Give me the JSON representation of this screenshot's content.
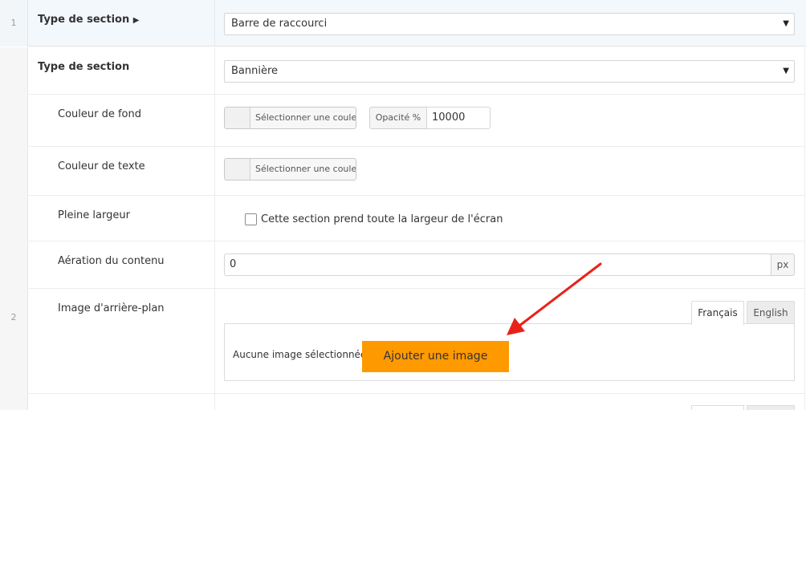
{
  "rows": {
    "row1_number": "1",
    "row2_number": "2"
  },
  "section1": {
    "label": "Type de section",
    "label_icon": "caret-right-icon",
    "select_value": "Barre de raccourci"
  },
  "section2": {
    "label": "Type de section",
    "select_value": "Bannière",
    "bg_color": {
      "label": "Couleur de fond",
      "button_label": "Sélectionner une couleur",
      "opacity_label": "Opacité %",
      "opacity_value": "10000"
    },
    "text_color": {
      "label": "Couleur de texte",
      "button_label": "Sélectionner une couleur"
    },
    "full_width": {
      "label": "Pleine largeur",
      "checkbox_label": "Cette section prend toute la largeur de l'écran",
      "checked": false
    },
    "padding": {
      "label": "Aération du contenu",
      "value": "0",
      "unit": "px"
    },
    "background_image": {
      "label": "Image d'arrière-plan",
      "tabs": [
        "Français",
        "English"
      ],
      "active_tab": "Français",
      "no_image_text": "Aucune image sélectionnée",
      "add_button_label": "Ajouter une image"
    }
  },
  "colors": {
    "accent_orange": "#ff9900",
    "annotation_red": "#e8221b",
    "highlight_row_bg": "#f3f8fd"
  }
}
